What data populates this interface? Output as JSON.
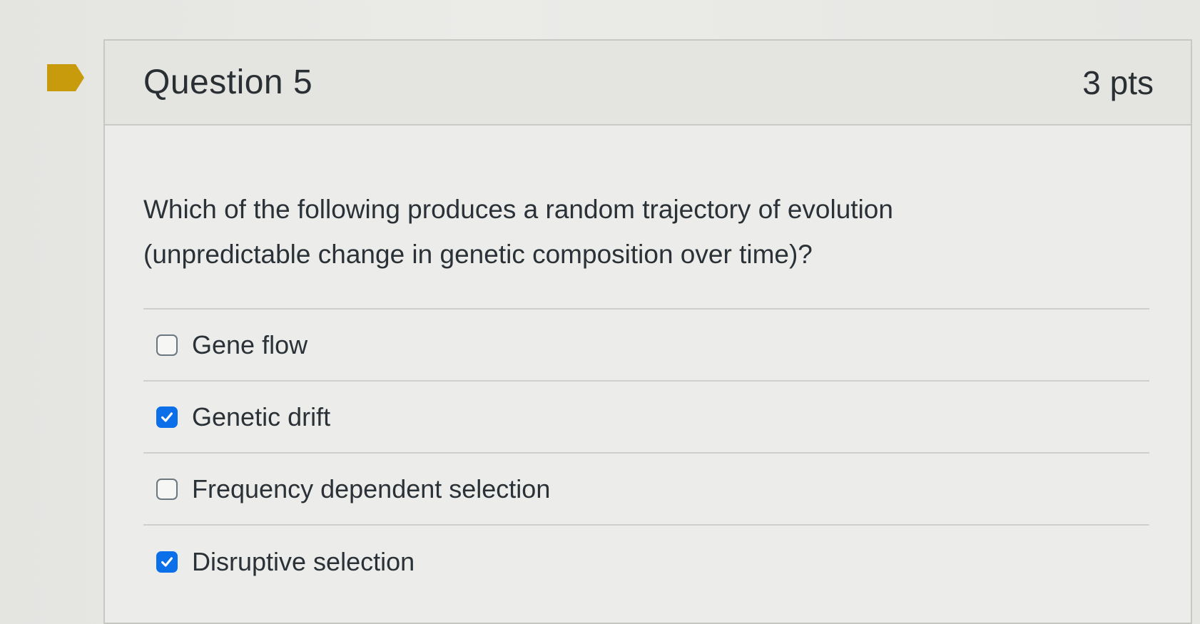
{
  "question": {
    "title": "Question 5",
    "points": "3 pts",
    "text_line1": "Which of the following produces a random trajectory of evolution",
    "text_line2": "(unpredictable change in genetic composition over time)?",
    "answers": [
      {
        "label": "Gene flow",
        "checked": false
      },
      {
        "label": "Genetic drift",
        "checked": true
      },
      {
        "label": "Frequency dependent selection",
        "checked": false
      },
      {
        "label": "Disruptive selection",
        "checked": true
      }
    ]
  },
  "colors": {
    "flag": "#c89b0c",
    "checkbox_checked": "#0a6fe8",
    "checkbox_border": "#6b7780"
  },
  "icons": {
    "flag": "flag-icon",
    "checkmark": "checkmark-icon"
  }
}
